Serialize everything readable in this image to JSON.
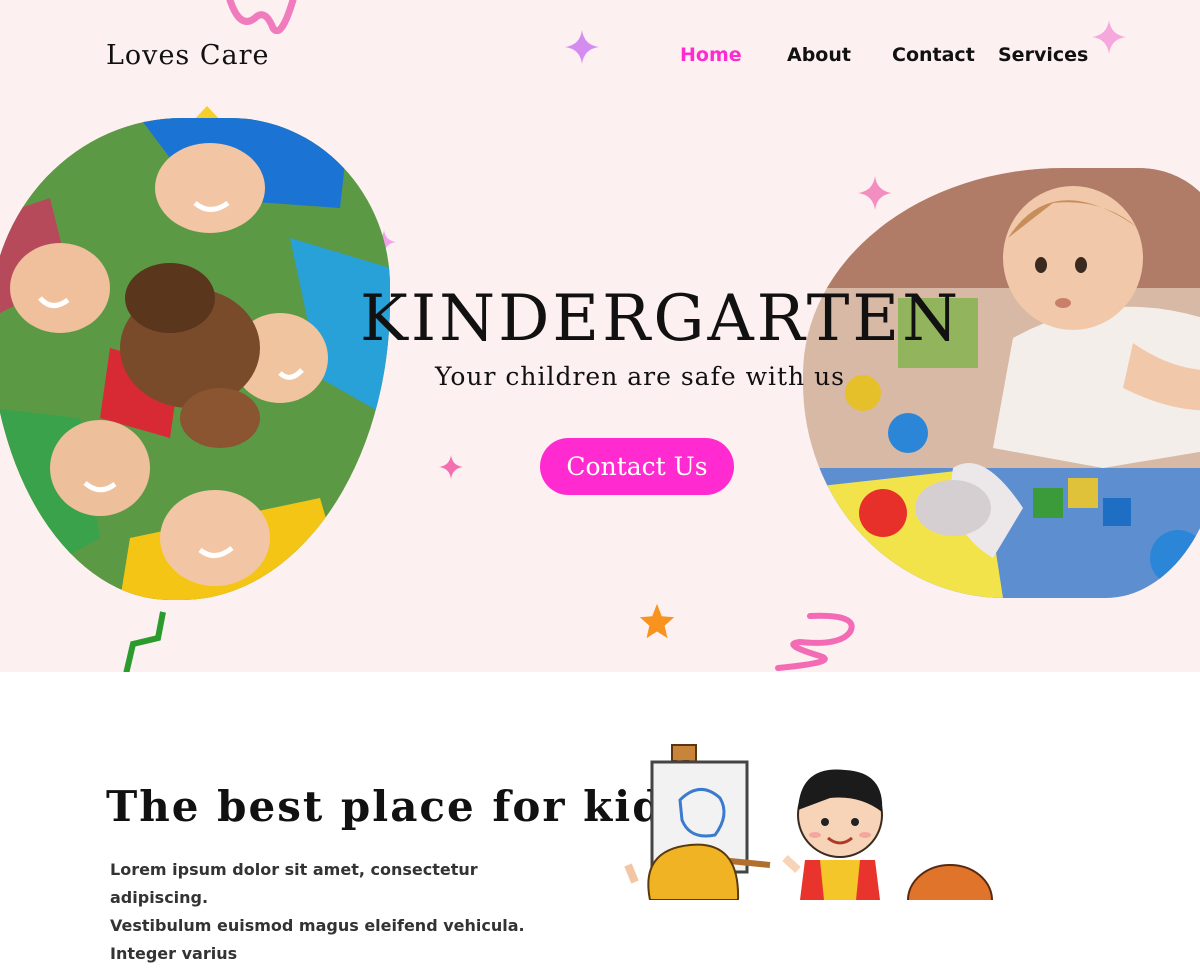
{
  "brand": {
    "logo": "Loves Care"
  },
  "nav": {
    "items": [
      "Home",
      "About",
      "Contact",
      "Services"
    ],
    "active": "Home"
  },
  "hero": {
    "title": "KINDERGARTEN",
    "subtitle": "Your children are safe with us",
    "cta_label": "Contact Us"
  },
  "section": {
    "title": "The best place for kids",
    "body_line1": "Lorem ipsum dolor sit amet, consectetur adipiscing.",
    "body_line2": "Vestibulum euismod magus eleifend vehicula. Integer varius"
  },
  "colors": {
    "accent": "#ff2bd0",
    "hero_bg": "#fdf0f0",
    "text": "#111111"
  }
}
